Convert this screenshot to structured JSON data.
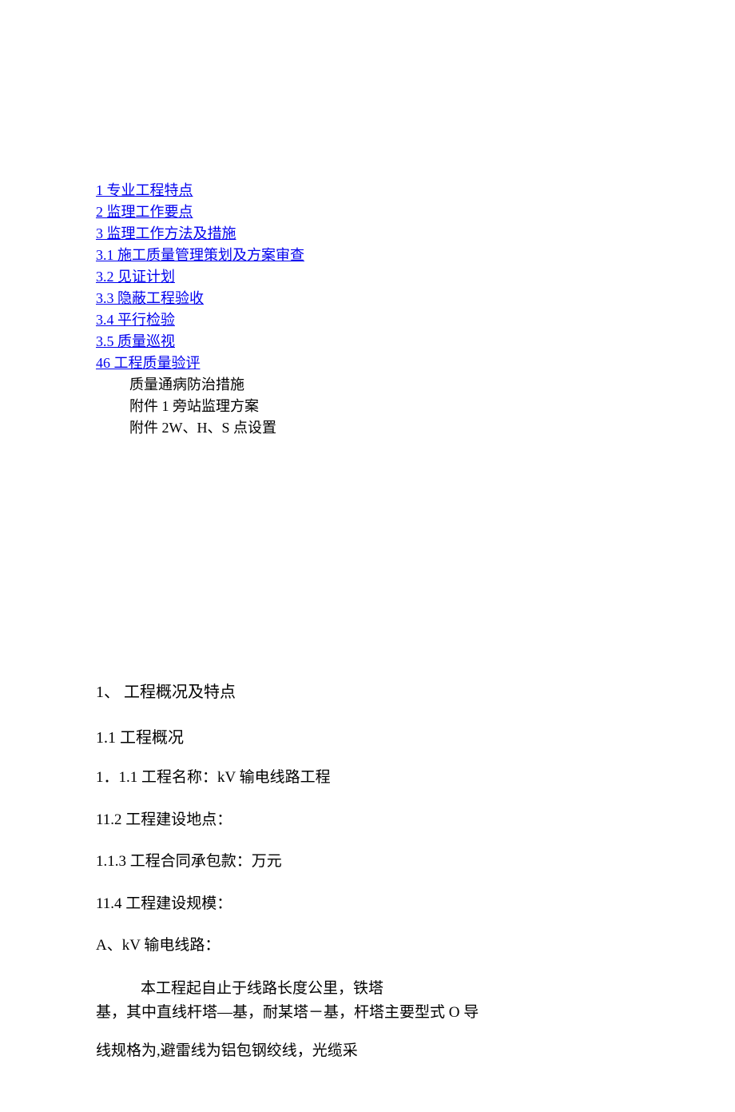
{
  "toc": {
    "links": [
      "1 专业工程特点",
      "2 监理工作要点",
      "3 监理工作方法及措施",
      "3.1 施工质量管理策划及方案审查",
      "3.2 见证计划",
      "3.3 隐蔽工程验收",
      "3.4 平行检验",
      "3.5 质量巡视",
      "46 工程质量验评"
    ],
    "plain": [
      "质量通病防治措施",
      "附件 1 旁站监理方案",
      "附件 2W、H、S 点设置"
    ]
  },
  "content": {
    "h1": "1、   工程概况及特点",
    "h11": "1.1   工程概况",
    "l1": "1．1.1 工程名称：kV 输电线路工程",
    "l2": "11.2 工程建设地点：",
    "l3": "1.1.3 工程合同承包款：万元",
    "l4": "11.4 工程建设规模：",
    "l5": "A、kV 输电线路：",
    "p1a": "本工程起自止于线路长度公里，铁塔",
    "p1b": "基，其中直线杆塔—基，耐某塔－基，杆塔主要型式 O 导",
    "p2": "线规格为,避雷线为铝包钢绞线，光缆采"
  }
}
